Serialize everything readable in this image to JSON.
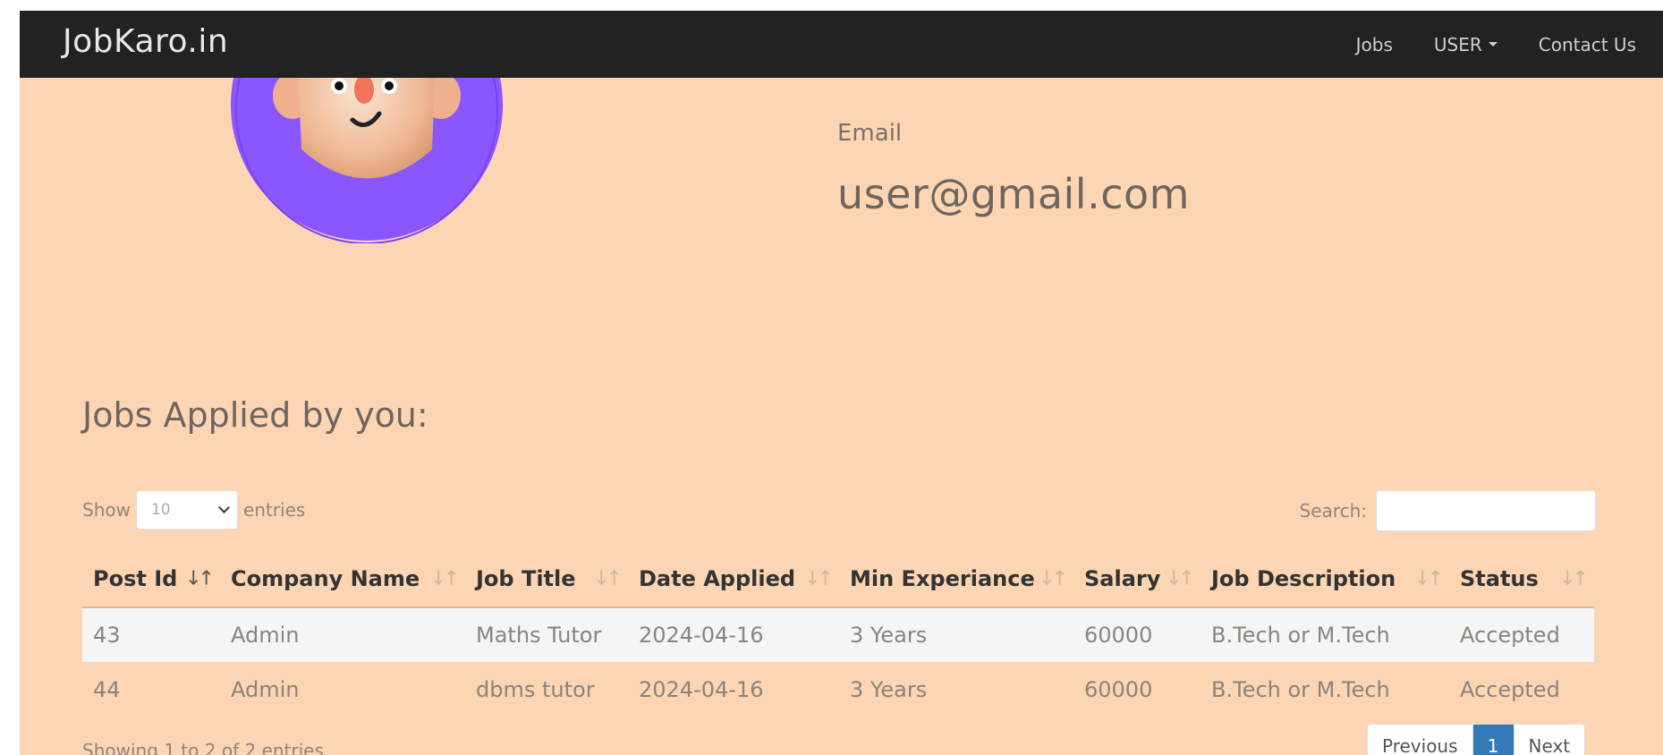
{
  "navbar": {
    "brand": "JobKaro.in",
    "links": [
      "Jobs",
      "USER",
      "Contact Us"
    ]
  },
  "profile": {
    "avatar_icon": "cartoon-face-avatar",
    "email_label": "Email",
    "email_value": "user@gmail.com"
  },
  "section_title": "Jobs Applied by you:",
  "table_controls": {
    "show_label": "Show",
    "entries_value": "10",
    "entries_label": "entries",
    "search_label": "Search:",
    "search_value": ""
  },
  "table": {
    "columns": [
      "Post Id",
      "Company Name",
      "Job Title",
      "Date Applied",
      "Min Experiance",
      "Salary",
      "Job Description",
      "Status"
    ],
    "rows": [
      [
        "43",
        "Admin",
        "Maths Tutor",
        "2024-04-16",
        "3 Years",
        "60000",
        "B.Tech or M.Tech",
        "Accepted"
      ],
      [
        "44",
        "Admin",
        "dbms tutor",
        "2024-04-16",
        "3 Years",
        "60000",
        "B.Tech or M.Tech",
        "Accepted"
      ]
    ]
  },
  "footer": {
    "info": "Showing 1 to 2 of 2 entries",
    "previous": "Previous",
    "current_page": "1",
    "next": "Next"
  },
  "colors": {
    "navbar_bg": "#222222",
    "page_bg": "#fdd5b2",
    "avatar_ring": "#8a56ff",
    "pager_active": "#337ab7"
  }
}
